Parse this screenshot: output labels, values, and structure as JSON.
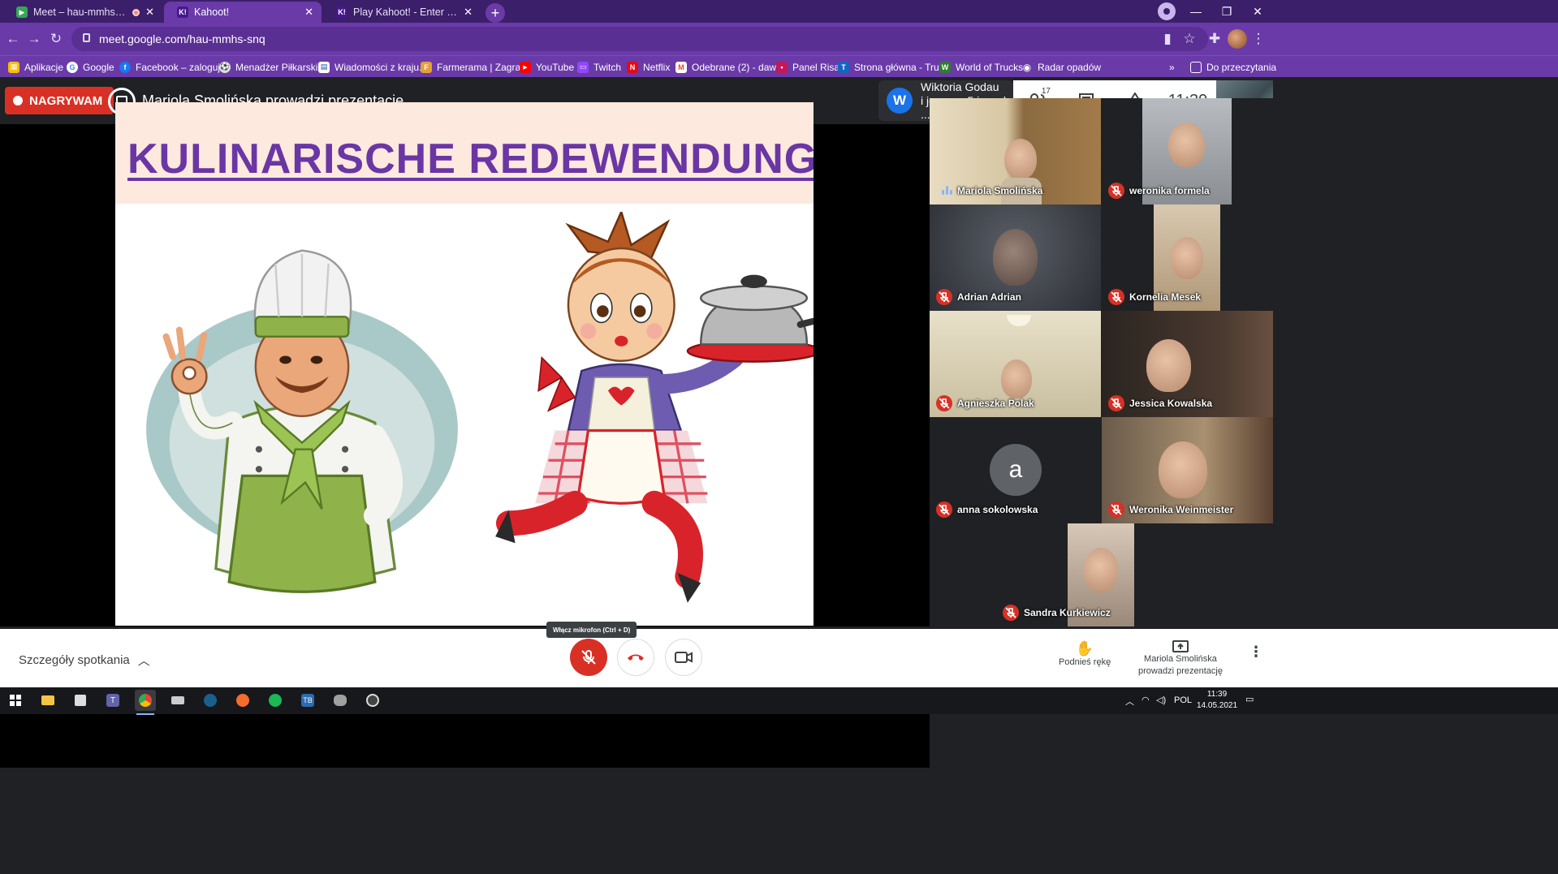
{
  "browser": {
    "tabs": [
      {
        "title": "Meet – hau-mmhs-snq",
        "favicon_color": "#34a853",
        "active": false,
        "recording": true
      },
      {
        "title": "Kahoot!",
        "favicon_color": "#46178f",
        "active": true,
        "recording": false
      },
      {
        "title": "Play Kahoot! - Enter game PIN he...",
        "favicon_color": "#46178f",
        "active": false,
        "recording": false
      }
    ],
    "url": "meet.google.com/hau-mmhs-snq",
    "bookmarks": [
      {
        "label": "Aplikacje",
        "icon": "apps-grid-icon",
        "color": "#fbbc04"
      },
      {
        "label": "Google",
        "icon": "google-icon",
        "color": "#ffffff"
      },
      {
        "label": "Facebook – zaloguj...",
        "icon": "facebook-icon",
        "color": "#1877f2"
      },
      {
        "label": "Menadżer Piłkarski...",
        "icon": "soccer-ball-icon",
        "color": "#dddddd"
      },
      {
        "label": "Wiadomości z kraju...",
        "icon": "news-icon",
        "color": "#ffffff"
      },
      {
        "label": "Farmerama | Zagraj...",
        "icon": "farmerama-icon",
        "color": "#e3a03a"
      },
      {
        "label": "YouTube",
        "icon": "youtube-icon",
        "color": "#ff0000"
      },
      {
        "label": "Twitch",
        "icon": "twitch-icon",
        "color": "#9146ff"
      },
      {
        "label": "Netflix",
        "icon": "netflix-icon",
        "color": "#e50914"
      },
      {
        "label": "Odebrane (2) - daw...",
        "icon": "gmail-icon",
        "color": "#ea4335"
      },
      {
        "label": "Panel Risa",
        "icon": "panel-icon",
        "color": "#c2185b"
      },
      {
        "label": "Strona główna - Tru...",
        "icon": "truck-icon",
        "color": "#1565c0"
      },
      {
        "label": "World of Trucks",
        "icon": "world-of-trucks-icon",
        "color": "#2e7d32"
      },
      {
        "label": "Radar opadów",
        "icon": "radar-icon",
        "color": "#ffffff"
      }
    ],
    "reading_list": "Do przeczytania"
  },
  "meet": {
    "recording_label": "NAGRYWAM",
    "presenting_text": "Mariola Smolińska prowadzi prezentację",
    "chip_initial": "W",
    "chip_line1": "Wiktoria Godau",
    "chip_line2": "i jeszcze 5 innych ...",
    "participant_count": "17",
    "time": "11:39",
    "slide": {
      "title": "KULINARISCHE  REDEWENDUNGEN",
      "title_color": "#6a36a4",
      "header_bg": "#fde9de"
    },
    "tiles": [
      {
        "name": "Mariola Smolińska",
        "talking": true
      },
      {
        "name": "weronika formela",
        "talking": false
      },
      {
        "name": "Adrian Adrian",
        "talking": false
      },
      {
        "name": "Kornelia Mesek",
        "talking": false
      },
      {
        "name": "Agnieszka Polak",
        "talking": false
      },
      {
        "name": "Jessica Kowalska",
        "talking": false
      },
      {
        "name": "anna sokolowska",
        "talking": false,
        "avatar_letter": "a"
      },
      {
        "name": "Weronika Weinmeister",
        "talking": false
      },
      {
        "name": "Sandra Kurkiewicz",
        "talking": false
      }
    ],
    "details_label": "Szczegóły spotkania",
    "mic_tooltip": "Włącz mikrofon (Ctrl + D)",
    "raise_hand": "Podnieś rękę",
    "presenter_line1": "Mariola Smolińska",
    "presenter_line2": "prowadzi prezentację"
  },
  "taskbar": {
    "lang": "POL",
    "time": "11:39",
    "date": "14.05.2021"
  }
}
